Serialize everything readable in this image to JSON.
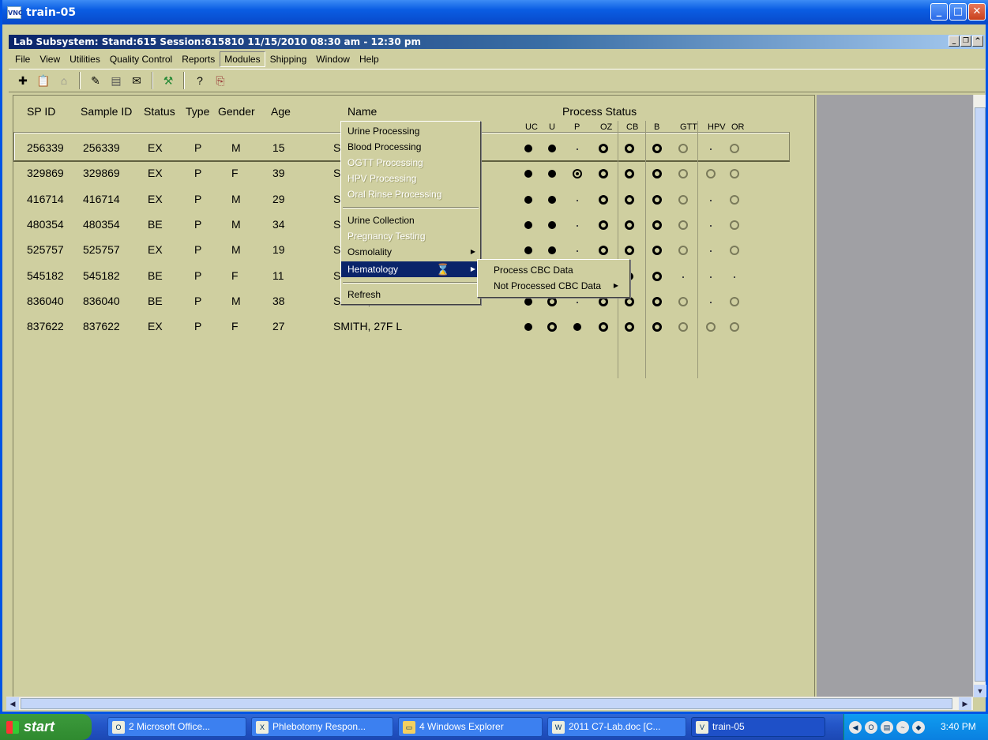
{
  "window": {
    "title": "train-05",
    "mdi_title": "Lab Subsystem: Stand:615 Session:615810 11/15/2010 08:30 am - 12:30 pm"
  },
  "menubar": [
    "File",
    "View",
    "Utilities",
    "Quality Control",
    "Reports",
    "Modules",
    "Shipping",
    "Window",
    "Help"
  ],
  "toolbar_icons": [
    "new-icon",
    "clipboard-icon",
    "tray-icon",
    "wand-icon",
    "printer-icon",
    "envelope-icon",
    "tools-icon",
    "help-icon",
    "exit-icon"
  ],
  "grid": {
    "headers": {
      "sp_id": "SP ID",
      "sample_id": "Sample ID",
      "status": "Status",
      "type": "Type",
      "gender": "Gender",
      "age": "Age",
      "name": "Name",
      "process_status": "Process Status"
    },
    "process_cols": [
      "UC",
      "U",
      "P",
      "OZ",
      "CB",
      "B",
      "GTT",
      "HPV",
      "OR"
    ],
    "rows": [
      {
        "sp": "256339",
        "sample": "256339",
        "status": "EX",
        "type": "P",
        "gender": "M",
        "age": "15",
        "name": "SM",
        "proc": [
          "dot",
          "dot",
          "tick",
          "ring",
          "ring",
          "ring",
          "gring",
          "tick",
          "gring"
        ]
      },
      {
        "sp": "329869",
        "sample": "329869",
        "status": "EX",
        "type": "P",
        "gender": "F",
        "age": "39",
        "name": "SM",
        "proc": [
          "dot",
          "dot",
          "bullseye",
          "ring",
          "ring",
          "ring",
          "gring",
          "gring",
          "gring"
        ]
      },
      {
        "sp": "416714",
        "sample": "416714",
        "status": "EX",
        "type": "P",
        "gender": "M",
        "age": "29",
        "name": "SM",
        "proc": [
          "dot",
          "dot",
          "tick",
          "ring",
          "ring",
          "ring",
          "gring",
          "tick",
          "gring"
        ]
      },
      {
        "sp": "480354",
        "sample": "480354",
        "status": "BE",
        "type": "P",
        "gender": "M",
        "age": "34",
        "name": "SM",
        "proc": [
          "dot",
          "dot",
          "tick",
          "ring",
          "ring",
          "ring",
          "gring",
          "tick",
          "gring"
        ]
      },
      {
        "sp": "525757",
        "sample": "525757",
        "status": "EX",
        "type": "P",
        "gender": "M",
        "age": "19",
        "name": "SM",
        "proc": [
          "dot",
          "dot",
          "tick",
          "ring",
          "ring",
          "ring",
          "gring",
          "tick",
          "gring"
        ]
      },
      {
        "sp": "545182",
        "sample": "545182",
        "status": "BE",
        "type": "P",
        "gender": "F",
        "age": "11",
        "name": "SM",
        "proc": [
          "dot",
          "ring",
          "dot",
          "ring",
          "dot",
          "ring",
          "tick",
          "tick",
          "tick"
        ]
      },
      {
        "sp": "836040",
        "sample": "836040",
        "status": "BE",
        "type": "P",
        "gender": "M",
        "age": "38",
        "name": "SMITH, 38M S",
        "proc": [
          "dot",
          "ring",
          "tick",
          "ring",
          "ring",
          "ring",
          "gring",
          "tick",
          "gring"
        ]
      },
      {
        "sp": "837622",
        "sample": "837622",
        "status": "EX",
        "type": "P",
        "gender": "F",
        "age": "27",
        "name": "SMITH, 27F L",
        "proc": [
          "dot",
          "ring",
          "dot",
          "ring",
          "ring",
          "ring",
          "gring",
          "gring",
          "gring"
        ]
      }
    ]
  },
  "modules_menu": [
    {
      "label": "Urine Processing",
      "enabled": true
    },
    {
      "label": "Blood Processing",
      "enabled": true
    },
    {
      "label": "OGTT Processing",
      "enabled": false
    },
    {
      "label": "HPV Processing",
      "enabled": false
    },
    {
      "label": "Oral Rinse Processing",
      "enabled": false
    },
    {
      "label": "Urine Collection",
      "enabled": true
    },
    {
      "label": "Pregnancy Testing",
      "enabled": false
    },
    {
      "label": "Osmolality",
      "enabled": true
    },
    {
      "label": "Hematology",
      "enabled": true
    },
    {
      "label": "Refresh",
      "enabled": true
    }
  ],
  "hematology_submenu": [
    "Process CBC Data",
    "Not Processed CBC Data"
  ],
  "taskbar": {
    "start": "start",
    "tasks": [
      "2 Microsoft Office...",
      "Phlebotomy Respon...",
      "4 Windows Explorer",
      "2011 C7-Lab.doc [C...",
      "train-05"
    ],
    "clock": "3:40 PM"
  }
}
